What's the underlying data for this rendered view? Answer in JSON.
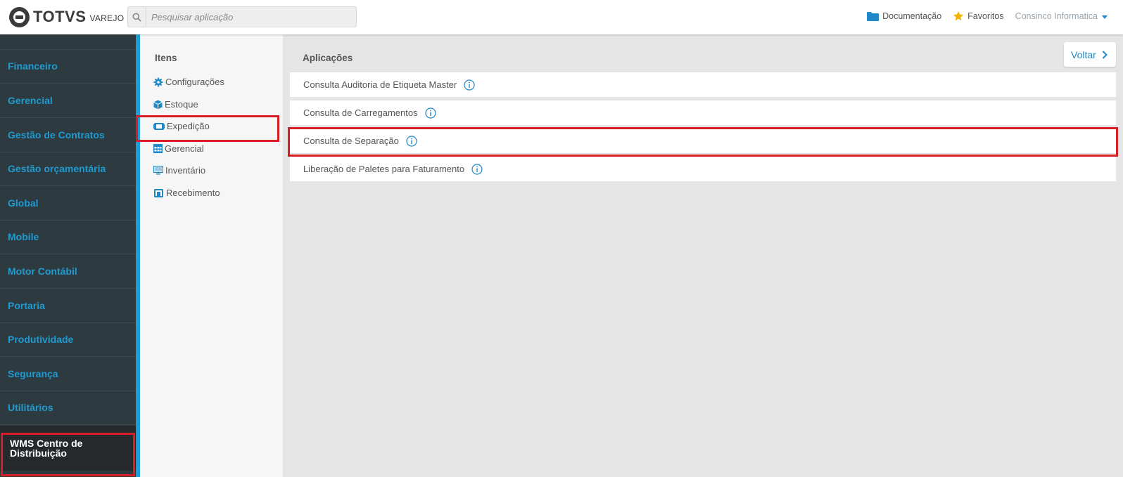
{
  "header": {
    "logo_main": "TOTVS",
    "logo_sub": "VAREJO",
    "search_placeholder": "Pesquisar aplicação",
    "links": {
      "documentation": "Documentação",
      "favorites": "Favoritos",
      "user": "Consinco Informatica"
    }
  },
  "sidebar": {
    "items": [
      {
        "label": "Financeiro"
      },
      {
        "label": "Gerencial"
      },
      {
        "label": "Gestão de Contratos"
      },
      {
        "label": "Gestão orçamentária"
      },
      {
        "label": "Global"
      },
      {
        "label": "Mobile"
      },
      {
        "label": "Motor Contábil"
      },
      {
        "label": "Portaria"
      },
      {
        "label": "Produtividade"
      },
      {
        "label": "Segurança"
      },
      {
        "label": "Utilitários"
      }
    ],
    "active": {
      "line1": "WMS Centro de",
      "line2": "Distribuição"
    }
  },
  "itens": {
    "title": "Itens",
    "items": [
      {
        "label": "Configurações",
        "icon": "gear-icon"
      },
      {
        "label": "Estoque",
        "icon": "box-icon"
      },
      {
        "label": "Expedição",
        "icon": "truck-icon"
      },
      {
        "label": "Gerencial",
        "icon": "table-icon"
      },
      {
        "label": "Inventário",
        "icon": "monitor-icon"
      },
      {
        "label": "Recebimento",
        "icon": "building-icon"
      }
    ]
  },
  "main": {
    "title": "Aplicações",
    "back_label": "Voltar",
    "apps": [
      {
        "label": "Consulta Auditoria de Etiqueta Master"
      },
      {
        "label": "Consulta de Carregamentos"
      },
      {
        "label": "Consulta de Separação"
      },
      {
        "label": "Liberação de Paletes para Faturamento"
      }
    ]
  },
  "colors": {
    "accent": "#1e88c8",
    "sidebar_bg": "#2d3a40",
    "sidebar_text": "#1f9bd1",
    "highlight": "#d81e24",
    "favorite_star": "#f5b301"
  }
}
